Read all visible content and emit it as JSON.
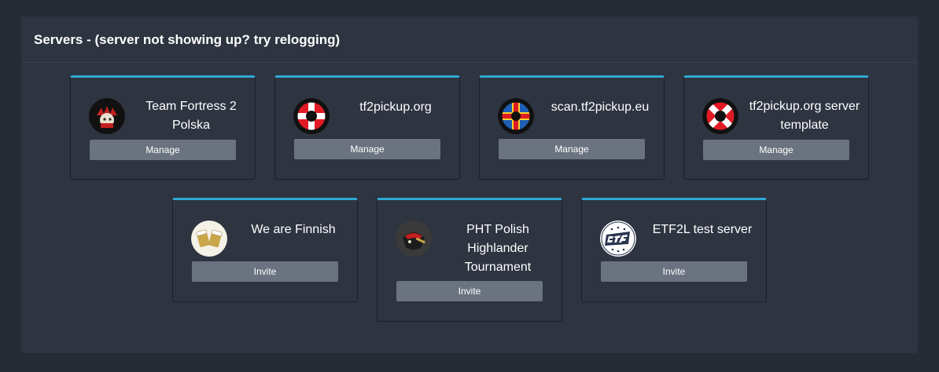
{
  "panel": {
    "title": "Servers - (server not showing up? try relogging)"
  },
  "servers": [
    {
      "name": "Team Fortress 2 Polska",
      "action": "Manage",
      "icon": "tf2-polska-logo"
    },
    {
      "name": "tf2pickup.org",
      "action": "Manage",
      "icon": "tf2pickup-logo"
    },
    {
      "name": "scan.tf2pickup.eu",
      "action": "Manage",
      "icon": "scan-tf2pickup-logo"
    },
    {
      "name": "tf2pickup.org server template",
      "action": "Manage",
      "icon": "tf2pickup-template-logo"
    },
    {
      "name": "We are Finnish",
      "action": "Invite",
      "icon": "we-are-finnish-logo"
    },
    {
      "name": "PHT Polish Highlander Tournament",
      "action": "Invite",
      "icon": "pht-logo"
    },
    {
      "name": "ETF2L test server",
      "action": "Invite",
      "icon": "etf2l-logo"
    }
  ],
  "colors": {
    "accent": "#2ea9d6",
    "button": "#6b7380",
    "panel": "#2e3440",
    "background": "#262b35"
  }
}
